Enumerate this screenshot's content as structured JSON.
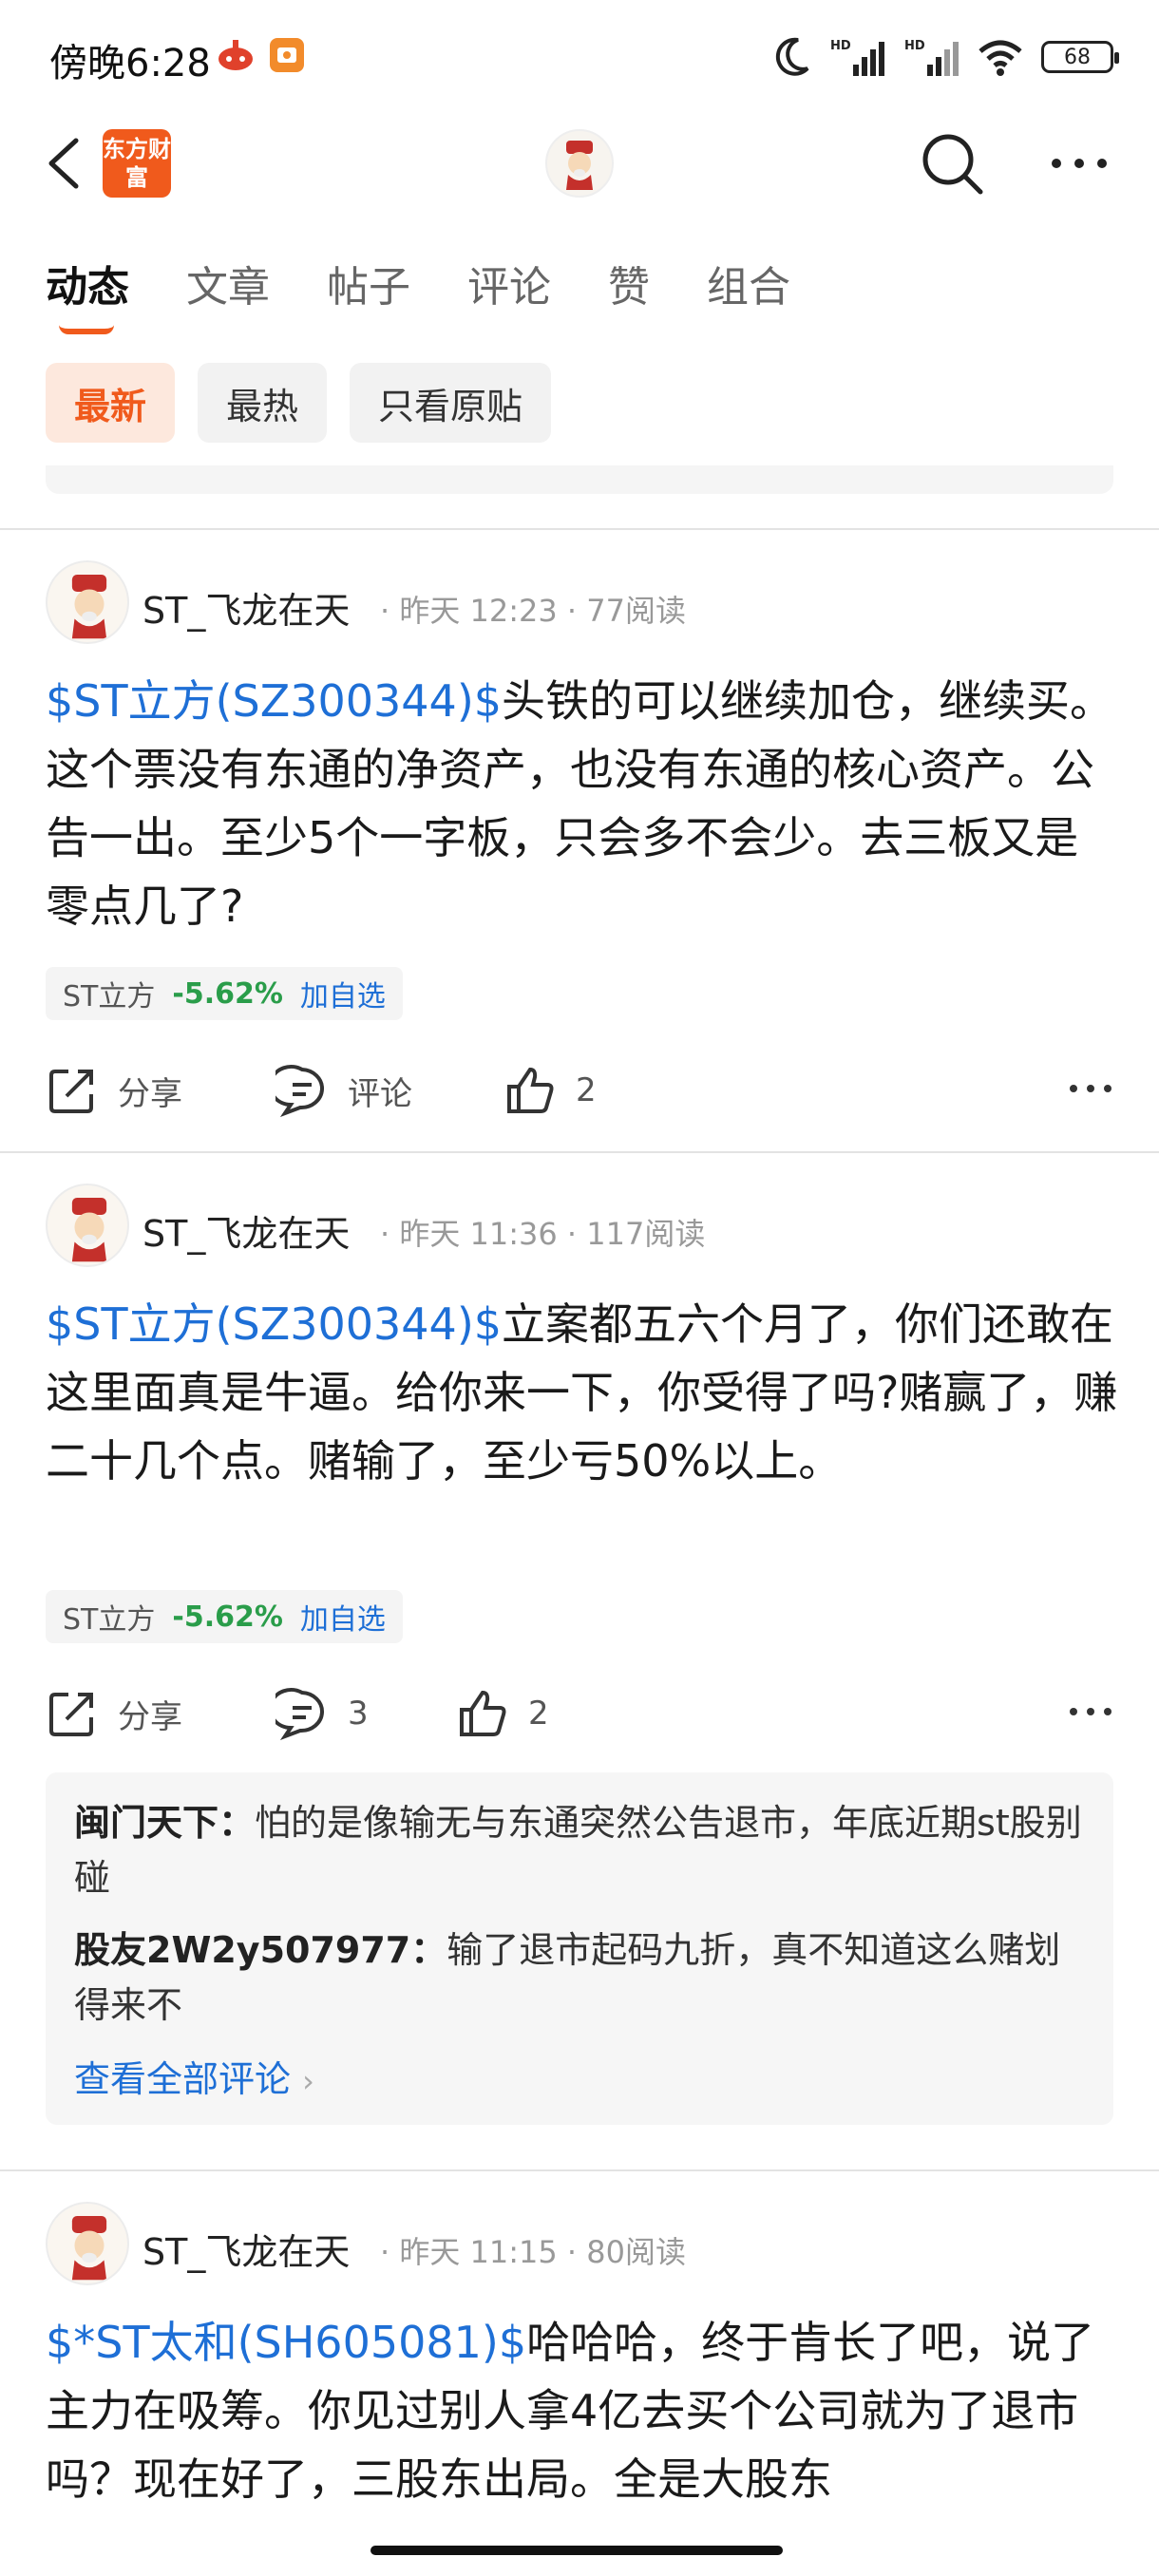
{
  "status_bar": {
    "time": "傍晚6:28",
    "network_1": "HD",
    "network_2": "HD",
    "battery": "68"
  },
  "header": {
    "logo_text": "东方财富"
  },
  "tabs": [
    {
      "label": "动态",
      "active": true
    },
    {
      "label": "文章"
    },
    {
      "label": "帖子"
    },
    {
      "label": "评论"
    },
    {
      "label": "赞"
    },
    {
      "label": "组合"
    }
  ],
  "filters": [
    {
      "label": "最新",
      "active": true
    },
    {
      "label": "最热"
    },
    {
      "label": "只看原贴"
    }
  ],
  "posts": [
    {
      "author": "ST_飞龙在天",
      "time": "昨天 12:23",
      "reads": "77阅读",
      "stock_link": "$ST立方(SZ300344)$",
      "body": "头铁的可以继续加仓，继续买。这个票没有东通的净资产，也没有东通的核心资产。公告一出。至少5个一字板，只会多不会少。去三板又是零点几了?",
      "tag_name": "ST立方",
      "tag_pct": "-5.62%",
      "tag_add": "加自选",
      "share": "分享",
      "comment": "评论",
      "likes": "2"
    },
    {
      "author": "ST_飞龙在天",
      "time": "昨天 11:36",
      "reads": "117阅读",
      "stock_link": "$ST立方(SZ300344)$",
      "body": "立案都五六个月了，你们还敢在这里面真是牛逼。给你来一下，你受得了吗?赌赢了，赚二十几个点。赌输了，至少亏50%以上。",
      "tag_name": "ST立方",
      "tag_pct": "-5.62%",
      "tag_add": "加自选",
      "share": "分享",
      "comment": "3",
      "likes": "2",
      "comments": [
        {
          "user": "闽门天下：",
          "text": "怕的是像输无与东通突然公告退市，年底近期st股别碰"
        },
        {
          "user": "股友2W2y507977：",
          "text": "输了退市起码九折，真不知道这么赌划得来不"
        }
      ],
      "view_all": "查看全部评论"
    },
    {
      "author": "ST_飞龙在天",
      "time": "昨天 11:15",
      "reads": "80阅读",
      "stock_link": "$*ST太和(SH605081)$",
      "body": "哈哈哈，终于肯长了吧，说了主力在吸筹。你见过别人拿4亿去买个公司就为了退市吗？现在好了，三股东出局。全是大股东"
    }
  ],
  "colors": {
    "accent": "#f05a1c",
    "link": "#1e6fd6",
    "down_green": "#2a9d4a"
  }
}
